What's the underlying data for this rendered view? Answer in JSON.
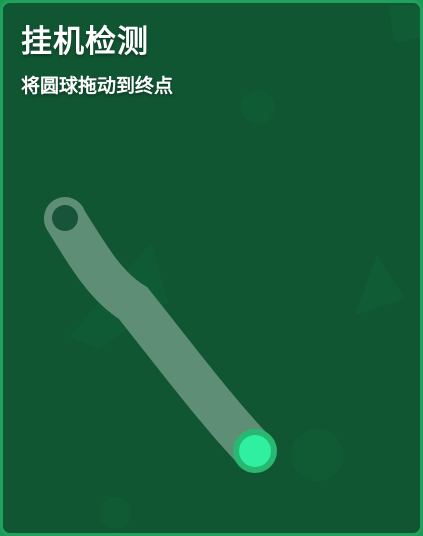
{
  "captcha": {
    "title": "挂机检测",
    "instruction": "将圆球拖动到终点"
  },
  "colors": {
    "frame_border": "#1fa25c",
    "background": "#115633",
    "decor_shape": "#0f5c35",
    "path": "#5f8e77",
    "start_ring": "#5f8e77",
    "start_hole": "#17543a",
    "ball_ring": "#28b872",
    "ball": "#2ff0a0"
  },
  "icons": {
    "start_marker": "circle-ring",
    "ball": "filled-circle"
  }
}
